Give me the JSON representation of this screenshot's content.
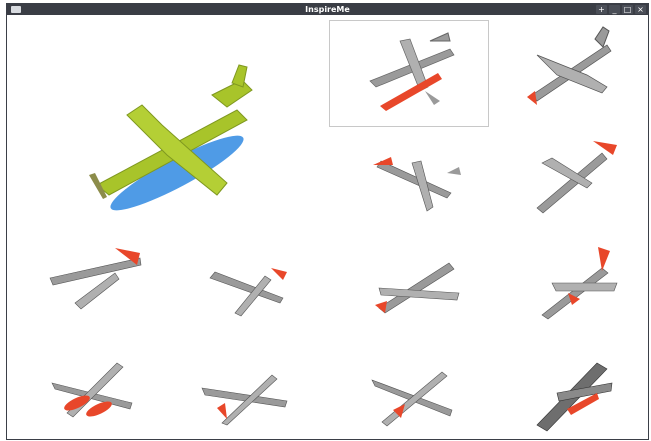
{
  "window": {
    "title": "InspireMe",
    "controls": [
      "+",
      "_",
      "□",
      "×"
    ]
  },
  "gallery": {
    "highlight_colors": {
      "accent": "#e8472a",
      "main_body": "#a8c42a",
      "float": "#4f9be6",
      "wire": "#8a8a8a"
    },
    "selected_index": 1,
    "count": 14
  }
}
